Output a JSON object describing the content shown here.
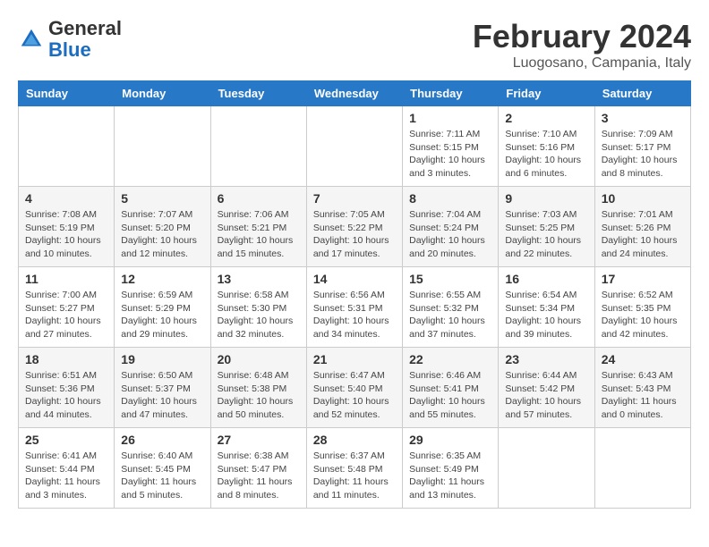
{
  "header": {
    "logo_general": "General",
    "logo_blue": "Blue",
    "month_year": "February 2024",
    "location": "Luogosano, Campania, Italy"
  },
  "days_of_week": [
    "Sunday",
    "Monday",
    "Tuesday",
    "Wednesday",
    "Thursday",
    "Friday",
    "Saturday"
  ],
  "weeks": [
    [
      {
        "num": "",
        "info": ""
      },
      {
        "num": "",
        "info": ""
      },
      {
        "num": "",
        "info": ""
      },
      {
        "num": "",
        "info": ""
      },
      {
        "num": "1",
        "info": "Sunrise: 7:11 AM\nSunset: 5:15 PM\nDaylight: 10 hours\nand 3 minutes."
      },
      {
        "num": "2",
        "info": "Sunrise: 7:10 AM\nSunset: 5:16 PM\nDaylight: 10 hours\nand 6 minutes."
      },
      {
        "num": "3",
        "info": "Sunrise: 7:09 AM\nSunset: 5:17 PM\nDaylight: 10 hours\nand 8 minutes."
      }
    ],
    [
      {
        "num": "4",
        "info": "Sunrise: 7:08 AM\nSunset: 5:19 PM\nDaylight: 10 hours\nand 10 minutes."
      },
      {
        "num": "5",
        "info": "Sunrise: 7:07 AM\nSunset: 5:20 PM\nDaylight: 10 hours\nand 12 minutes."
      },
      {
        "num": "6",
        "info": "Sunrise: 7:06 AM\nSunset: 5:21 PM\nDaylight: 10 hours\nand 15 minutes."
      },
      {
        "num": "7",
        "info": "Sunrise: 7:05 AM\nSunset: 5:22 PM\nDaylight: 10 hours\nand 17 minutes."
      },
      {
        "num": "8",
        "info": "Sunrise: 7:04 AM\nSunset: 5:24 PM\nDaylight: 10 hours\nand 20 minutes."
      },
      {
        "num": "9",
        "info": "Sunrise: 7:03 AM\nSunset: 5:25 PM\nDaylight: 10 hours\nand 22 minutes."
      },
      {
        "num": "10",
        "info": "Sunrise: 7:01 AM\nSunset: 5:26 PM\nDaylight: 10 hours\nand 24 minutes."
      }
    ],
    [
      {
        "num": "11",
        "info": "Sunrise: 7:00 AM\nSunset: 5:27 PM\nDaylight: 10 hours\nand 27 minutes."
      },
      {
        "num": "12",
        "info": "Sunrise: 6:59 AM\nSunset: 5:29 PM\nDaylight: 10 hours\nand 29 minutes."
      },
      {
        "num": "13",
        "info": "Sunrise: 6:58 AM\nSunset: 5:30 PM\nDaylight: 10 hours\nand 32 minutes."
      },
      {
        "num": "14",
        "info": "Sunrise: 6:56 AM\nSunset: 5:31 PM\nDaylight: 10 hours\nand 34 minutes."
      },
      {
        "num": "15",
        "info": "Sunrise: 6:55 AM\nSunset: 5:32 PM\nDaylight: 10 hours\nand 37 minutes."
      },
      {
        "num": "16",
        "info": "Sunrise: 6:54 AM\nSunset: 5:34 PM\nDaylight: 10 hours\nand 39 minutes."
      },
      {
        "num": "17",
        "info": "Sunrise: 6:52 AM\nSunset: 5:35 PM\nDaylight: 10 hours\nand 42 minutes."
      }
    ],
    [
      {
        "num": "18",
        "info": "Sunrise: 6:51 AM\nSunset: 5:36 PM\nDaylight: 10 hours\nand 44 minutes."
      },
      {
        "num": "19",
        "info": "Sunrise: 6:50 AM\nSunset: 5:37 PM\nDaylight: 10 hours\nand 47 minutes."
      },
      {
        "num": "20",
        "info": "Sunrise: 6:48 AM\nSunset: 5:38 PM\nDaylight: 10 hours\nand 50 minutes."
      },
      {
        "num": "21",
        "info": "Sunrise: 6:47 AM\nSunset: 5:40 PM\nDaylight: 10 hours\nand 52 minutes."
      },
      {
        "num": "22",
        "info": "Sunrise: 6:46 AM\nSunset: 5:41 PM\nDaylight: 10 hours\nand 55 minutes."
      },
      {
        "num": "23",
        "info": "Sunrise: 6:44 AM\nSunset: 5:42 PM\nDaylight: 10 hours\nand 57 minutes."
      },
      {
        "num": "24",
        "info": "Sunrise: 6:43 AM\nSunset: 5:43 PM\nDaylight: 11 hours\nand 0 minutes."
      }
    ],
    [
      {
        "num": "25",
        "info": "Sunrise: 6:41 AM\nSunset: 5:44 PM\nDaylight: 11 hours\nand 3 minutes."
      },
      {
        "num": "26",
        "info": "Sunrise: 6:40 AM\nSunset: 5:45 PM\nDaylight: 11 hours\nand 5 minutes."
      },
      {
        "num": "27",
        "info": "Sunrise: 6:38 AM\nSunset: 5:47 PM\nDaylight: 11 hours\nand 8 minutes."
      },
      {
        "num": "28",
        "info": "Sunrise: 6:37 AM\nSunset: 5:48 PM\nDaylight: 11 hours\nand 11 minutes."
      },
      {
        "num": "29",
        "info": "Sunrise: 6:35 AM\nSunset: 5:49 PM\nDaylight: 11 hours\nand 13 minutes."
      },
      {
        "num": "",
        "info": ""
      },
      {
        "num": "",
        "info": ""
      }
    ]
  ]
}
